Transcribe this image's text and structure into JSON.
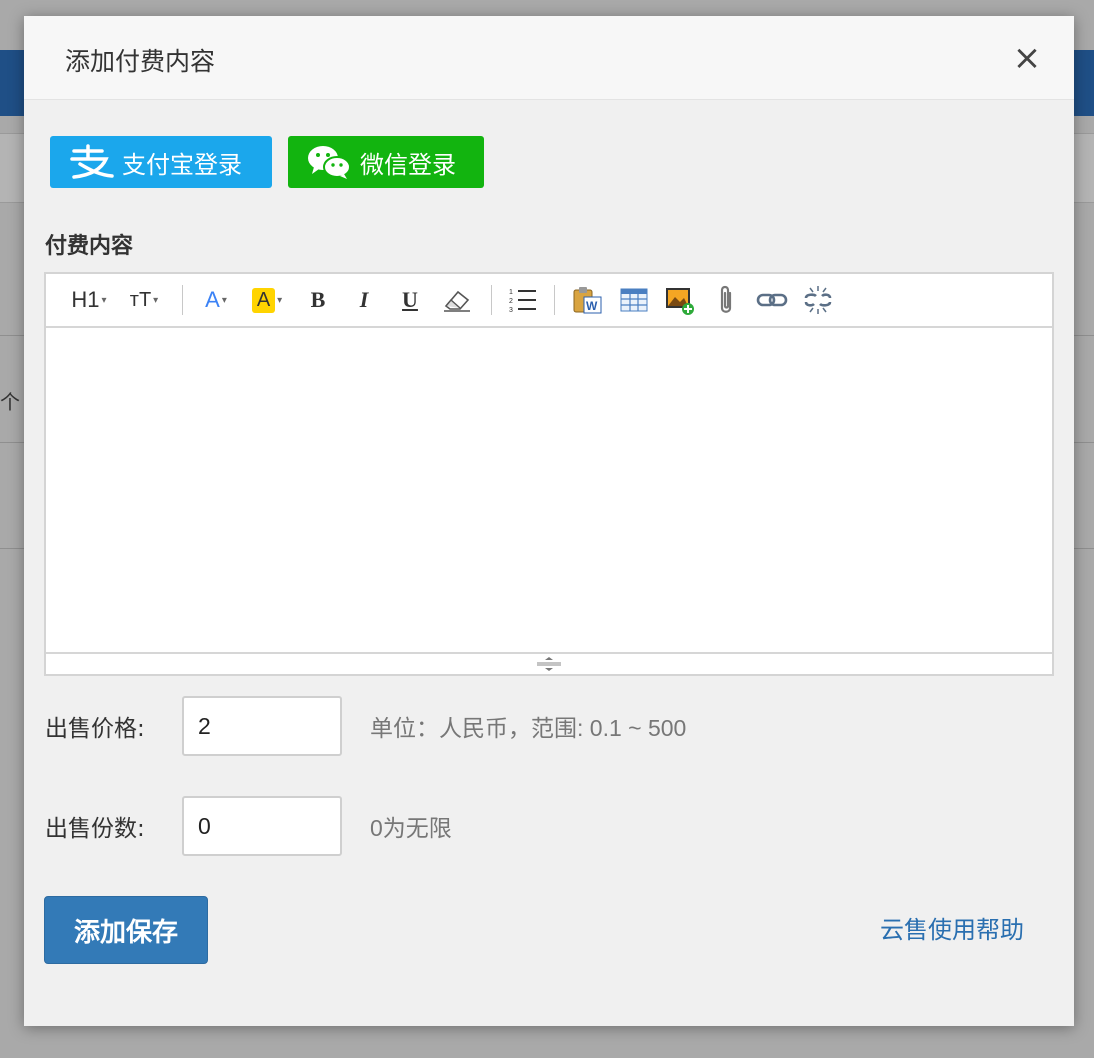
{
  "background": {
    "peek_text": "个"
  },
  "modal": {
    "title": "添加付费内容",
    "close_label": "×"
  },
  "login": {
    "alipay_label": "支付宝登录",
    "wechat_label": "微信登录",
    "alipay_color": "#1ba7ec",
    "wechat_color": "#12b40f"
  },
  "content_section": {
    "label": "付费内容"
  },
  "editor": {
    "toolbar": [
      {
        "name": "heading-icon",
        "glyph": "H1"
      },
      {
        "name": "font-size-icon",
        "glyph": "тT"
      },
      {
        "name": "font-color-icon",
        "glyph": "A"
      },
      {
        "name": "highlight-color-icon",
        "glyph": "A"
      },
      {
        "name": "bold-icon",
        "glyph": "B"
      },
      {
        "name": "italic-icon",
        "glyph": "I"
      },
      {
        "name": "underline-icon",
        "glyph": "U"
      },
      {
        "name": "eraser-icon",
        "glyph": ""
      },
      {
        "name": "ordered-list-icon",
        "glyph": ""
      },
      {
        "name": "paste-word-icon",
        "glyph": ""
      },
      {
        "name": "table-icon",
        "glyph": ""
      },
      {
        "name": "insert-image-icon",
        "glyph": ""
      },
      {
        "name": "attachment-icon",
        "glyph": ""
      },
      {
        "name": "link-icon",
        "glyph": ""
      },
      {
        "name": "unlink-icon",
        "glyph": ""
      }
    ]
  },
  "price": {
    "label": "出售价格:",
    "value": "2",
    "hint": "单位：人民币，范围: 0.1 ~ 500"
  },
  "quantity": {
    "label": "出售份数:",
    "value": "0",
    "hint": "0为无限"
  },
  "actions": {
    "save_label": "添加保存",
    "help_label": "云售使用帮助",
    "primary_color": "#337ab7",
    "link_color": "#2a6fb0"
  }
}
